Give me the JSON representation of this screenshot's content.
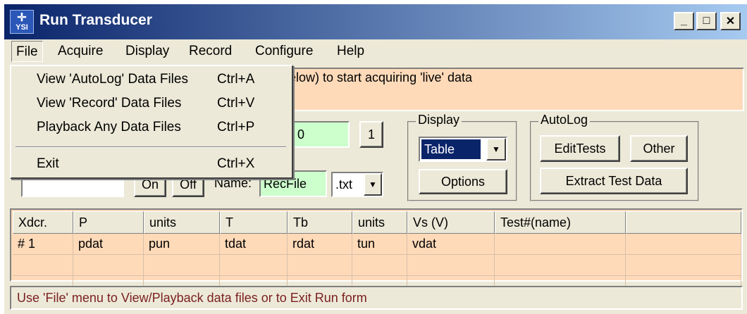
{
  "window": {
    "title": "Run Transducer",
    "icon": "ysi-logo-icon",
    "icon_text": "YSI",
    "controls": {
      "minimize": "_",
      "maximize": "□",
      "close": "✕"
    }
  },
  "menubar": {
    "items": [
      {
        "label": "File"
      },
      {
        "label": "Acquire"
      },
      {
        "label": "Display"
      },
      {
        "label": "Record"
      },
      {
        "label": "Configure"
      },
      {
        "label": "Help"
      }
    ]
  },
  "file_menu": {
    "items": [
      {
        "label": "View 'AutoLog' Data Files",
        "shortcut": "Ctrl+A"
      },
      {
        "label": "View 'Record' Data Files",
        "shortcut": "Ctrl+V"
      },
      {
        "label": "Playback Any Data Files",
        "shortcut": "Ctrl+P"
      },
      {
        "label": "Exit",
        "shortcut": "Ctrl+X"
      }
    ]
  },
  "banner": {
    "visible_text": "elow) to start acquiring 'live' data"
  },
  "acquire_panel": {
    "counter_value": "0",
    "step_button": "1"
  },
  "record_panel": {
    "input_value": "",
    "on_button": "On",
    "off_button": "Off",
    "name_label": "Name:",
    "name_value": "RecFile",
    "extension": ".txt"
  },
  "display_group": {
    "legend": "Display",
    "mode": "Table",
    "options_button": "Options"
  },
  "autolog_group": {
    "legend": "AutoLog",
    "edit_tests_button": "EditTests",
    "other_button": "Other",
    "extract_button": "Extract Test Data"
  },
  "grid": {
    "columns": [
      "Xdcr.",
      "P",
      "units",
      "T",
      "Tb",
      "units",
      "Vs (V)",
      "Test#(name)",
      ""
    ],
    "rows": [
      [
        "# 1",
        "pdat",
        "pun",
        "tdat",
        "rdat",
        "tun",
        "vdat",
        "",
        ""
      ],
      [
        "",
        "",
        "",
        "",
        "",
        "",
        "",
        "",
        ""
      ],
      [
        "",
        "",
        "",
        "",
        "",
        "",
        "",
        "",
        ""
      ]
    ]
  },
  "status_bar": {
    "text": "Use 'File' menu to View/Playback data files or to Exit Run form"
  },
  "colors": {
    "title_start": "#0a246a",
    "title_end": "#a6caf0",
    "peach": "#ffdab9",
    "field_green": "#ccffcc",
    "selection": "#0a246a"
  }
}
